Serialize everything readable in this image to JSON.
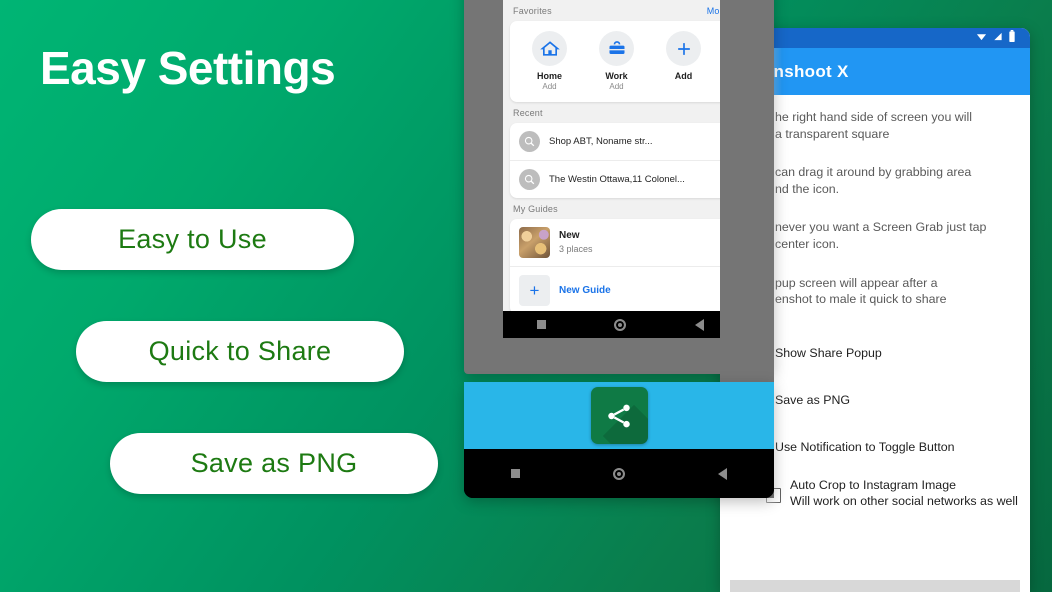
{
  "brand": {
    "green_light": "#00b574",
    "green_dark": "#046b42",
    "pill_text_color": "#1d7a12",
    "accent_blue": "#2196f3",
    "cyan": "#29b6e8"
  },
  "hero": {
    "headline": "Easy Settings",
    "pills": [
      {
        "label": "Easy to Use"
      },
      {
        "label": "Quick to Share"
      },
      {
        "label": "Save as PNG"
      }
    ]
  },
  "phone_maps": {
    "favorites": {
      "header": "Favorites",
      "more": "More",
      "items": [
        {
          "name": "Home",
          "sub": "Add",
          "icon": "home-icon"
        },
        {
          "name": "Work",
          "sub": "Add",
          "icon": "briefcase-icon"
        },
        {
          "name": "Add",
          "sub": "",
          "icon": "plus-icon"
        }
      ]
    },
    "recent": {
      "header": "Recent",
      "items": [
        {
          "label": "Shop ABT, Noname str...",
          "icon": "search-icon"
        },
        {
          "label": "The Westin Ottawa,11 Colonel...",
          "icon": "search-icon"
        }
      ]
    },
    "my_guides": {
      "header": "My Guides",
      "guide": {
        "title": "New",
        "sub": "3 places"
      },
      "new_guide": {
        "label": "New Guide",
        "icon": "plus-icon"
      }
    },
    "navbar": {
      "recents": "square-icon",
      "home": "circle-icon",
      "back": "triangle-back-icon"
    }
  },
  "phone_share": {
    "tile_icon": "share-icon",
    "navbar": {
      "recents": "square-icon",
      "home": "circle-icon",
      "back": "triangle-back-icon"
    }
  },
  "settings_panel": {
    "status_icons": [
      "wifi-icon",
      "signal-icon",
      "battery-icon"
    ],
    "title": "eenshoot X",
    "paragraphs": [
      {
        "line1": "he right hand side of screen you  will",
        "line2": "a transparent square"
      },
      {
        "line1": "can drag it around by  grabbing area",
        "line2": "nd the icon."
      },
      {
        "line1": "never you want a Screen Grab just tap",
        "line2": "center icon."
      },
      {
        "line1": "pup screen will appear after a",
        "line2": "enshot to male it quick to share"
      }
    ],
    "rows": [
      {
        "label": "Show Share Popup"
      },
      {
        "label": "Save as PNG"
      },
      {
        "label": "Use Notification to Toggle Button"
      }
    ],
    "checkbox_row": {
      "title": "Auto Crop to Instagram Image",
      "subtitle": "Will work on other social networks as well",
      "checked": false
    }
  }
}
